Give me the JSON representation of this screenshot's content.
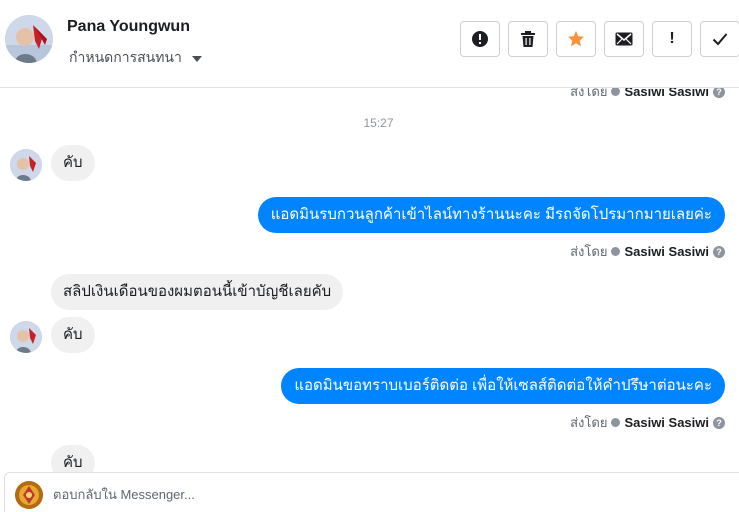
{
  "header": {
    "name": "Pana Youngwun",
    "assign_label": "กำหนดการสนทนา",
    "actions": [
      {
        "name": "report-button",
        "icon": "alert-circle-icon"
      },
      {
        "name": "delete-button",
        "icon": "trash-icon"
      },
      {
        "name": "star-button",
        "icon": "star-icon",
        "color": "#f7923a"
      },
      {
        "name": "mark-unread-button",
        "icon": "envelope-icon"
      },
      {
        "name": "important-button",
        "icon": "exclamation-icon",
        "text": "!"
      },
      {
        "name": "done-button",
        "icon": "check-icon"
      }
    ]
  },
  "messages": {
    "top_sent_prefix": "ส่งโดย",
    "top_sent_name": "Sasiwi Sasiwi",
    "time": "15:27",
    "m1": "คับ",
    "m2": "แอดมินรบกวนลูกค้าเข้าไลน์ทางร้านนะคะ มีรถจัดโปรมากมายเลยค่ะ",
    "m2_sent_prefix": "ส่งโดย",
    "m2_sent_name": "Sasiwi Sasiwi",
    "m3": "สลิปเงินเดือนของผมตอนนี้เข้าบัญชีเลยคับ",
    "m4": "คับ",
    "m5": "แอดมินขอทราบเบอร์ติดต่อ เพื่อให้เซลส์ติดต่อให้คำปรึษาต่อนะคะ",
    "m5_sent_prefix": "ส่งโดย",
    "m5_sent_name": "Sasiwi Sasiwi",
    "m6": "คับ",
    "help_glyph": "?"
  },
  "reply": {
    "placeholder": "ตอบกลับใน Messenger..."
  },
  "colors": {
    "outgoing_bubble": "#0084ff",
    "incoming_bubble": "#f0f0f0",
    "star": "#f7923a"
  }
}
